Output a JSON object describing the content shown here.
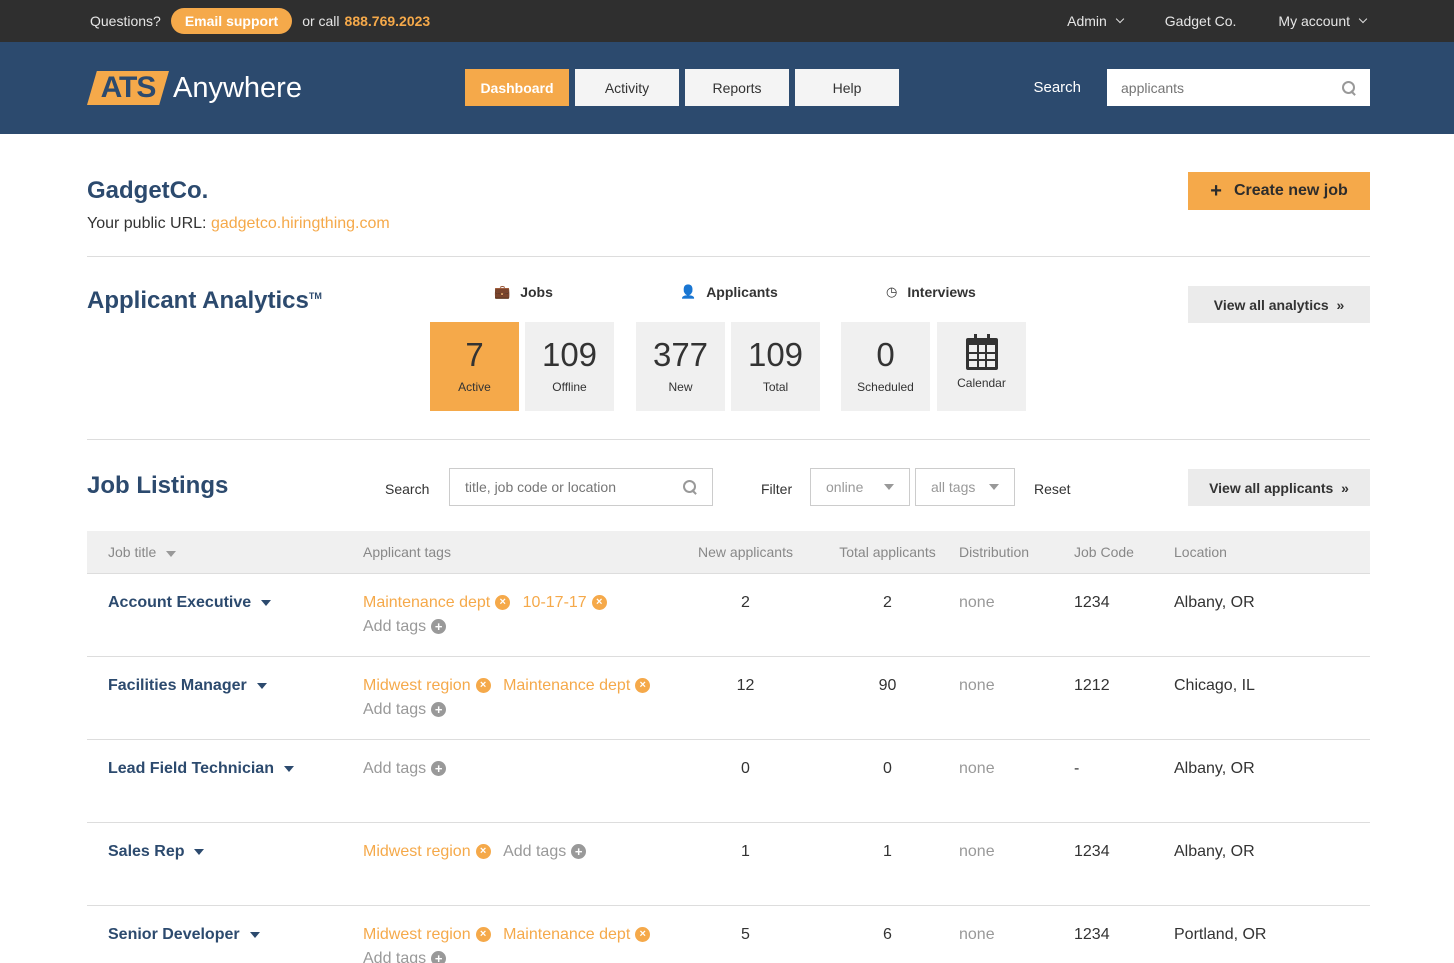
{
  "topbar": {
    "questions": "Questions?",
    "email_support": "Email support",
    "or_call": "or call",
    "phone": "888.769.2023",
    "admin": "Admin",
    "company": "Gadget Co.",
    "my_account": "My account"
  },
  "header": {
    "logo_ats": "ATS",
    "logo_anywhere": "Anywhere",
    "nav": [
      "Dashboard",
      "Activity",
      "Reports",
      "Help"
    ],
    "search_label": "Search",
    "search_placeholder": "applicants"
  },
  "company": {
    "name": "GadgetCo.",
    "url_label": "Your public URL:",
    "url": "gadgetco.hiringthing.com",
    "create_job": "Create new job"
  },
  "analytics": {
    "title": "Applicant Analytics",
    "tm": "TM",
    "groups": {
      "jobs": "Jobs",
      "applicants": "Applicants",
      "interviews": "Interviews"
    },
    "stats": [
      {
        "num": "7",
        "label": "Active"
      },
      {
        "num": "109",
        "label": "Offline"
      },
      {
        "num": "377",
        "label": "New"
      },
      {
        "num": "109",
        "label": "Total"
      },
      {
        "num": "0",
        "label": "Scheduled"
      },
      {
        "num": "",
        "label": "Calendar"
      }
    ],
    "view_all": "View all analytics"
  },
  "listings": {
    "title": "Job Listings",
    "search_label": "Search",
    "search_placeholder": "title, job code or location",
    "filter_label": "Filter",
    "filter_status": "online",
    "filter_tags": "all tags",
    "reset": "Reset",
    "view_all": "View all applicants",
    "columns": [
      "Job title",
      "Applicant tags",
      "New applicants",
      "Total applicants",
      "Distribution",
      "Job Code",
      "Location"
    ],
    "add_tags": "Add tags",
    "rows": [
      {
        "title": "Account Executive",
        "tags": [
          "Maintenance dept",
          "10-17-17"
        ],
        "new": "2",
        "total": "2",
        "distribution": "none",
        "code": "1234",
        "location": "Albany, OR"
      },
      {
        "title": "Facilities Manager",
        "tags": [
          "Midwest region",
          "Maintenance dept"
        ],
        "new": "12",
        "total": "90",
        "distribution": "none",
        "code": "1212",
        "location": "Chicago, IL"
      },
      {
        "title": "Lead Field Technician",
        "tags": [],
        "new": "0",
        "total": "0",
        "distribution": "none",
        "code": "-",
        "location": "Albany, OR"
      },
      {
        "title": "Sales Rep",
        "tags": [
          "Midwest region"
        ],
        "new": "1",
        "total": "1",
        "distribution": "none",
        "code": "1234",
        "location": "Albany, OR"
      },
      {
        "title": "Senior Developer",
        "tags": [
          "Midwest region",
          "Maintenance dept"
        ],
        "new": "5",
        "total": "6",
        "distribution": "none",
        "code": "1234",
        "location": "Portland, OR"
      }
    ]
  },
  "icons": {
    "caret": "chevron-down-icon",
    "search": "search-icon",
    "briefcase": "briefcase-icon",
    "user": "user-icon",
    "clock": "clock-icon",
    "calendar": "calendar-icon",
    "remove": "remove-tag-icon",
    "add": "add-tag-icon"
  },
  "colors": {
    "accent": "#f5a94a",
    "navy": "#2c4a6e",
    "topbar": "#2f2f2f"
  }
}
